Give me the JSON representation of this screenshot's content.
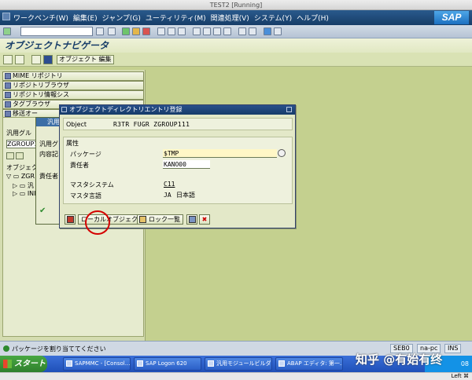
{
  "vm_window": {
    "title": "TEST2 [Running]"
  },
  "menubar": {
    "items": [
      "ワークベンチ(W)",
      "編集(E)",
      "ジャンプ(G)",
      "ユーティリティ(M)",
      "関連処理(V)",
      "システム(Y)",
      "ヘルプ(H)"
    ],
    "logo": "SAP"
  },
  "screen_title": "オブジェクトナビゲータ",
  "app_toolbar": {
    "object_edit": "オブジェクト 編集"
  },
  "left_nav": {
    "buttons": [
      "MIME リポジトリ",
      "リポジトリブラウザ",
      "リポジトリ情報シス",
      "タグブラウザ",
      "移送オー"
    ],
    "group_label": "汎用グル",
    "group_value": "ZGROUP1",
    "tree_title": "オブジェクト名",
    "tree": [
      "ZGR",
      "汎",
      "INI"
    ]
  },
  "back_dialog": {
    "title": "汎用",
    "label1": "汎用グ",
    "label2": "内容記",
    "label3": "責任者"
  },
  "dialog": {
    "title": "オブジェクトディレクトリエントリ登録",
    "object_label": "Object",
    "object_value": "R3TR FUGR ZGROUP111",
    "group_title": "属性",
    "package_label": "パッケージ",
    "package_value": "$TMP",
    "owner_label": "責任者",
    "owner_value": "KANO00",
    "master_system_label": "マスタシステム",
    "master_system_value": "C11",
    "master_lang_label": "マスタ言語",
    "master_lang_code": "JA",
    "master_lang_name": "日本語",
    "btn_local": "ローカルオブジェクト",
    "btn_lock": "ロック一覧"
  },
  "statusbar": {
    "message": "パッケージを割り当ててください",
    "system": "SEB0",
    "client": "na-pc",
    "mode": "INS"
  },
  "taskbar": {
    "start": "スタート",
    "tasks": [
      "SAPMMC - [Consol...",
      "SAP Logon 620",
      "汎用モジュールビルダ...",
      "ABAP エディタ: 第一..."
    ],
    "clock": "08"
  },
  "watermark": "知乎 @有始有终",
  "mac_bar": {
    "input": "Left ⌘"
  }
}
